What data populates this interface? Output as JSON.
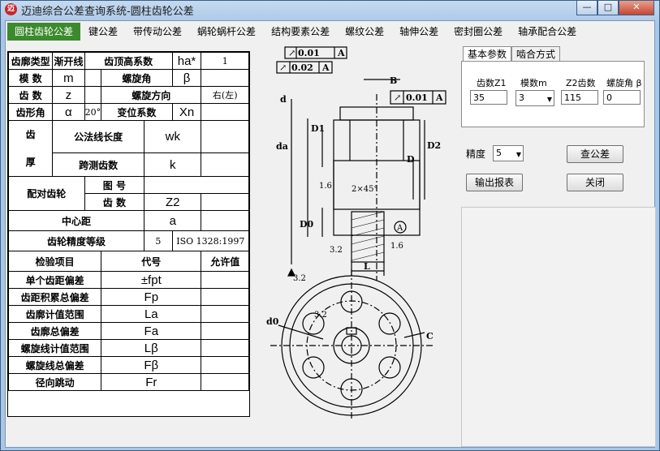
{
  "window": {
    "app_icon": "迈",
    "title": "迈迪综合公差查询系统-圆柱齿轮公差",
    "min": "—",
    "max": "□",
    "close": "✕"
  },
  "tabs": [
    "圆柱齿轮公差",
    "键公差",
    "带传动公差",
    "蜗轮蜗杆公差",
    "结构要素公差",
    "螺纹公差",
    "轴伸公差",
    "密封圈公差",
    "轴承配合公差"
  ],
  "spec": {
    "profile_type_label": "齿廓类型",
    "profile_type_value": "渐开线",
    "addendum_coef_label": "齿顶高系数",
    "addendum_coef_symbol": "ha*",
    "addendum_coef_value": "1",
    "module_label": "模 数",
    "module_symbol": "m",
    "helix_angle_label": "螺旋角",
    "helix_angle_symbol": "β",
    "teeth_label": "齿 数",
    "teeth_symbol": "z",
    "helix_dir_label": "螺旋方向",
    "helix_dir_value": "右(左)",
    "pressure_angle_label": "齿形角",
    "pressure_angle_symbol": "α",
    "pressure_angle_value": "20°",
    "shift_coef_label": "变位系数",
    "shift_coef_symbol": "Xn",
    "thickness_label_top": "齿",
    "thickness_label_bottom": "厚",
    "span_length_label": "公法线长度",
    "span_length_symbol": "wk",
    "span_teeth_label": "跨测齿数",
    "span_teeth_symbol": "k",
    "mating_gear_label": "配对齿轮",
    "drawing_no_label": "图 号",
    "mating_teeth_label": "齿 数",
    "mating_teeth_symbol": "Z2",
    "center_distance_label": "中心距",
    "center_distance_symbol": "a",
    "accuracy_label": "齿轮精度等级",
    "accuracy_value": "5",
    "accuracy_standard": "ISO 1328:1997",
    "check_items_header": "检验项目",
    "code_header": "代号",
    "allowance_header": "允许值",
    "checks": [
      {
        "name": "单个齿距偏差",
        "code": "±fpt"
      },
      {
        "name": "齿距积累总偏差",
        "code": "Fp"
      },
      {
        "name": "齿廓计值范围",
        "code": "La"
      },
      {
        "name": "齿廓总偏差",
        "code": "Fa"
      },
      {
        "name": "螺旋线计值范围",
        "code": "Lβ"
      },
      {
        "name": "螺旋线总偏差",
        "code": "Fβ"
      },
      {
        "name": "径向跳动",
        "code": "Fr"
      }
    ]
  },
  "drawing": {
    "tol1_value": "0.01",
    "tol1_datum": "A",
    "tol2_value": "0.02",
    "tol2_datum": "A",
    "tol3_value": "0.01",
    "tol3_datum": "A",
    "label_B": "B",
    "label_d": "d",
    "label_D1": "D1",
    "label_da": "da",
    "label_D2": "D2",
    "label_D": "D",
    "label_D0": "D0",
    "label_L": "L",
    "chamfer": "2×45°",
    "rough1": "1.6",
    "rough2": "3.2",
    "rough3": "3.2",
    "rough4": "3.2",
    "rough5": "1.6",
    "datum_A": "A",
    "label_d0": "d0",
    "label_C": "C"
  },
  "params": {
    "tab_basic": "基本参数",
    "tab_mesh": "啮合方式",
    "z1_label": "齿数Z1",
    "z1_value": "35",
    "m_label": "模数m",
    "m_value": "3",
    "z2_label": "Z2齿数",
    "z2_value": "115",
    "beta_label": "螺旋角 β",
    "beta_value": "0",
    "precision_label": "精度",
    "precision_value": "5",
    "query_button": "查公差",
    "export_button": "输出报表",
    "close_button": "关闭"
  }
}
